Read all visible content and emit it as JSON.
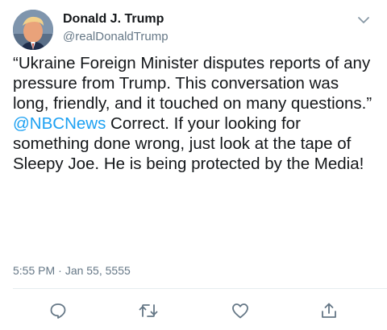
{
  "author": {
    "display_name": "Donald J. Trump",
    "handle": "@realDonaldTrump",
    "avatar_icon": "profile-photo"
  },
  "tweet": {
    "text_before": "“Ukraine Foreign Minister disputes reports of any pressure from Trump. This conversation was long, friendly, and it touched on many questions.” ",
    "mention": "@NBCNews",
    "text_after": " Correct. If your looking for something done wrong, just look at the tape of Sleepy Joe. He is being protected by the Media!",
    "time": "5:55 PM",
    "separator": "·",
    "date": "Jan 55, 5555"
  },
  "actions": [
    {
      "icon": "reply-icon"
    },
    {
      "icon": "retweet-icon"
    },
    {
      "icon": "like-icon"
    },
    {
      "icon": "share-icon"
    }
  ],
  "colors": {
    "text": "#14171a",
    "secondary": "#657786",
    "link": "#1da1f2",
    "divider": "#e6ecf0"
  }
}
